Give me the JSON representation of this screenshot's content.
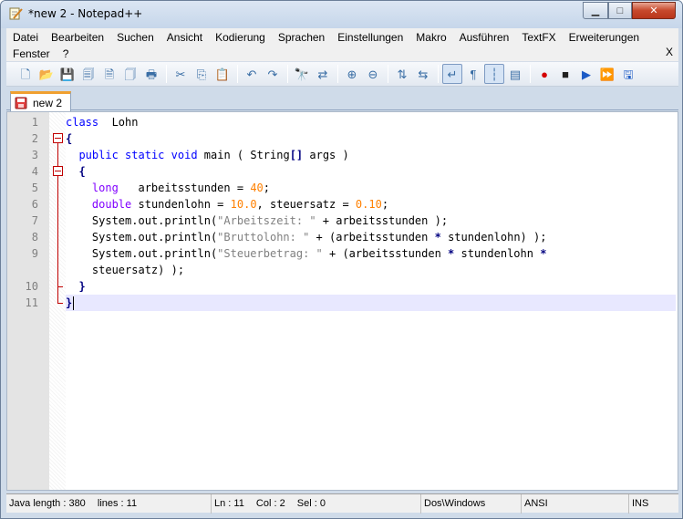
{
  "window": {
    "title": "*new  2 - Notepad++",
    "controls": {
      "minimize": "▁",
      "maximize": "□",
      "close": "✕"
    }
  },
  "menu": {
    "row1": [
      "Datei",
      "Bearbeiten",
      "Suchen",
      "Ansicht",
      "Kodierung",
      "Sprachen",
      "Einstellungen",
      "Makro",
      "Ausführen",
      "TextFX",
      "Erweiterungen"
    ],
    "row2": [
      "Fenster",
      "?"
    ],
    "close_doc": "X"
  },
  "toolbar": {
    "buttons": [
      {
        "name": "new-file-icon",
        "glyph": "🗋"
      },
      {
        "name": "open-file-icon",
        "glyph": "📂"
      },
      {
        "name": "save-icon",
        "glyph": "💾"
      },
      {
        "name": "save-all-icon",
        "glyph": "🗐"
      },
      {
        "name": "close-file-icon",
        "glyph": "🗎"
      },
      {
        "name": "close-all-icon",
        "glyph": "🗍"
      },
      {
        "name": "print-icon",
        "glyph": "🖶"
      },
      {
        "sep": true
      },
      {
        "name": "cut-icon",
        "glyph": "✂"
      },
      {
        "name": "copy-icon",
        "glyph": "⎘"
      },
      {
        "name": "paste-icon",
        "glyph": "📋"
      },
      {
        "sep": true
      },
      {
        "name": "undo-icon",
        "glyph": "↶"
      },
      {
        "name": "redo-icon",
        "glyph": "↷"
      },
      {
        "sep": true
      },
      {
        "name": "find-icon",
        "glyph": "🔭"
      },
      {
        "name": "replace-icon",
        "glyph": "⇄"
      },
      {
        "sep": true
      },
      {
        "name": "zoom-in-icon",
        "glyph": "⊕"
      },
      {
        "name": "zoom-out-icon",
        "glyph": "⊖"
      },
      {
        "sep": true
      },
      {
        "name": "sync-vertical-icon",
        "glyph": "⇅"
      },
      {
        "name": "sync-horizontal-icon",
        "glyph": "⇆"
      },
      {
        "sep": true
      },
      {
        "name": "word-wrap-icon",
        "glyph": "↵",
        "pressed": true
      },
      {
        "name": "show-all-chars-icon",
        "glyph": "¶"
      },
      {
        "name": "indent-guide-icon",
        "glyph": "┆",
        "pressed": true
      },
      {
        "name": "doc-map-icon",
        "glyph": "▤"
      },
      {
        "sep": true
      },
      {
        "name": "record-macro-icon",
        "glyph": "●",
        "color": "#d40000"
      },
      {
        "name": "stop-macro-icon",
        "glyph": "■",
        "color": "#202020"
      },
      {
        "name": "play-macro-icon",
        "glyph": "▶",
        "color": "#1c5bc6"
      },
      {
        "name": "run-macro-multiple-icon",
        "glyph": "⏩",
        "color": "#1c5bc6"
      },
      {
        "name": "save-macro-icon",
        "glyph": "🖫",
        "color": "#1c5bc6"
      }
    ]
  },
  "tabs": [
    {
      "label": "new  2",
      "active": true
    }
  ],
  "editor": {
    "lines": [
      {
        "n": "1",
        "tokens": [
          [
            "kw",
            "class"
          ],
          [
            "",
            "  Lohn"
          ]
        ]
      },
      {
        "n": "2",
        "tokens": [
          [
            "op",
            "{"
          ]
        ]
      },
      {
        "n": "3",
        "tokens": [
          [
            "",
            "  "
          ],
          [
            "kw",
            "public"
          ],
          [
            "",
            " "
          ],
          [
            "kw",
            "static"
          ],
          [
            "",
            " "
          ],
          [
            "kw",
            "void"
          ],
          [
            "",
            " main ( String"
          ],
          [
            "op",
            "[]"
          ],
          [
            "",
            " args )"
          ]
        ]
      },
      {
        "n": "4",
        "tokens": [
          [
            "",
            "  "
          ],
          [
            "op",
            "{"
          ]
        ]
      },
      {
        "n": "5",
        "tokens": [
          [
            "",
            "    "
          ],
          [
            "type",
            "long"
          ],
          [
            "",
            "   arbeitsstunden = "
          ],
          [
            "num",
            "40"
          ],
          [
            "",
            ";"
          ]
        ]
      },
      {
        "n": "6",
        "tokens": [
          [
            "",
            "    "
          ],
          [
            "type",
            "double"
          ],
          [
            "",
            " stundenlohn = "
          ],
          [
            "num",
            "10.0"
          ],
          [
            "",
            ", steuersatz = "
          ],
          [
            "num",
            "0.10"
          ],
          [
            "",
            ";"
          ]
        ]
      },
      {
        "n": "7",
        "tokens": [
          [
            "",
            "    System.out.println("
          ],
          [
            "str",
            "\"Arbeitszeit: \""
          ],
          [
            "",
            " + arbeitsstunden );"
          ]
        ]
      },
      {
        "n": "8",
        "tokens": [
          [
            "",
            "    System.out.println("
          ],
          [
            "str",
            "\"Bruttolohn: \""
          ],
          [
            "",
            " + (arbeitsstunden "
          ],
          [
            "op",
            "*"
          ],
          [
            "",
            " stundenlohn) );"
          ]
        ]
      },
      {
        "n": "9",
        "tokens": [
          [
            "",
            "    System.out.println("
          ],
          [
            "str",
            "\"Steuerbetrag: \""
          ],
          [
            "",
            " + (arbeitsstunden "
          ],
          [
            "op",
            "*"
          ],
          [
            "",
            " stundenlohn "
          ],
          [
            "op",
            "*"
          ]
        ]
      },
      {
        "n": "",
        "tokens": [
          [
            "",
            "    steuersatz) );"
          ]
        ]
      },
      {
        "n": "10",
        "tokens": [
          [
            "",
            "  "
          ],
          [
            "op",
            "}"
          ]
        ]
      },
      {
        "n": "11",
        "tokens": [
          [
            "op",
            "}"
          ]
        ]
      }
    ]
  },
  "status": {
    "language": "Java",
    "length_label": "length : 380",
    "lines_label": "lines : 11",
    "ln": "Ln : 11",
    "col": "Col : 2",
    "sel": "Sel : 0",
    "eol": "Dos\\Windows",
    "encoding": "ANSI",
    "mode": "INS"
  }
}
